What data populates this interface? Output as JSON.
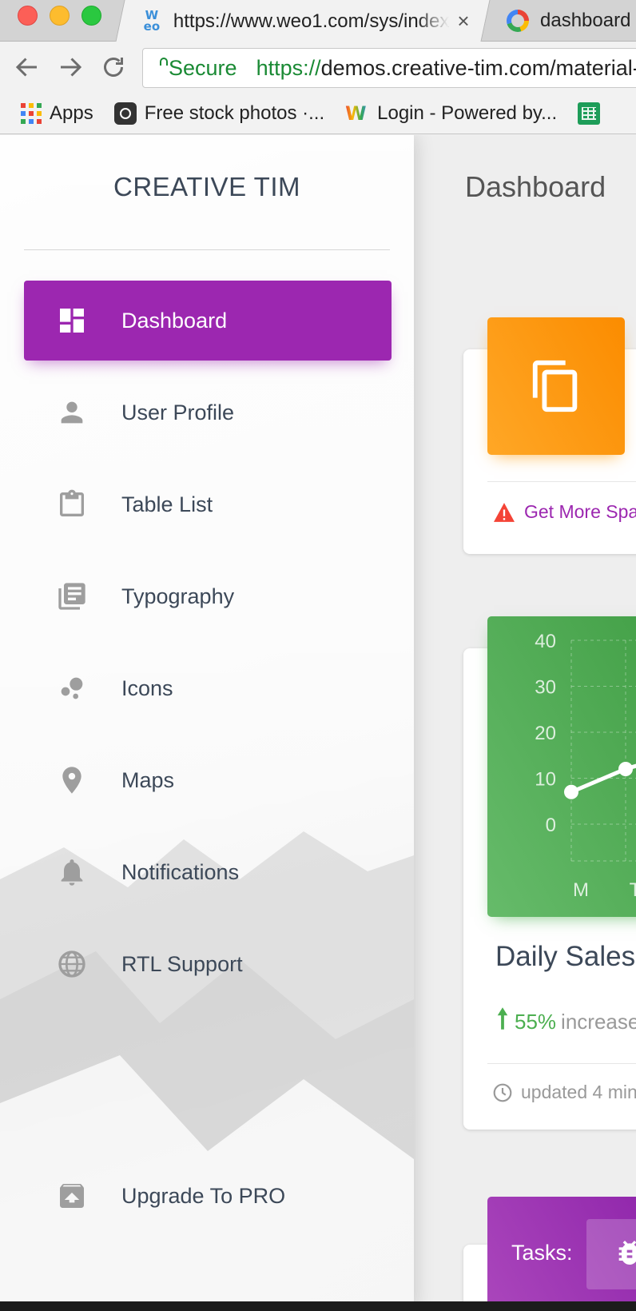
{
  "browser": {
    "active_tab": {
      "title": "https://www.weo1.com/sys/index",
      "close": "×"
    },
    "second_tab": {
      "title": "dashboard"
    },
    "url": {
      "secure_label": "Secure",
      "scheme": "https://",
      "rest": "demos.creative-tim.com/material-dashboard"
    },
    "bookmarks": [
      {
        "label": "Apps",
        "icon": "apps-grid-icon"
      },
      {
        "label": "Free stock photos ·...",
        "icon": "instagram-icon"
      },
      {
        "label": "Login - Powered by...",
        "icon": "w-logo-icon"
      },
      {
        "label": "",
        "icon": "sheets-icon"
      }
    ]
  },
  "sidebar": {
    "brand": "CREATIVE TIM",
    "items": [
      {
        "label": "Dashboard",
        "icon": "dashboard-icon",
        "active": true
      },
      {
        "label": "User Profile",
        "icon": "person-icon"
      },
      {
        "label": "Table List",
        "icon": "clipboard-icon"
      },
      {
        "label": "Typography",
        "icon": "library-books-icon"
      },
      {
        "label": "Icons",
        "icon": "bubble-chart-icon"
      },
      {
        "label": "Maps",
        "icon": "location-pin-icon"
      },
      {
        "label": "Notifications",
        "icon": "bell-icon"
      },
      {
        "label": "RTL Support",
        "icon": "globe-icon"
      }
    ],
    "upgrade": {
      "label": "Upgrade To PRO",
      "icon": "unarchive-icon"
    }
  },
  "main": {
    "title": "Dashboard",
    "card_used_space": {
      "icon": "content-copy-icon",
      "footer_link": "Get More Spa",
      "footer_icon": "warning-icon",
      "accent": "#ff9800"
    },
    "card_daily_sales": {
      "title": "Daily Sales",
      "stat_value": "55%",
      "stat_text": "increase",
      "footer": "updated 4 min",
      "accent": "#4caf50"
    },
    "card_tasks": {
      "label": "Tasks:",
      "icon": "bug-icon",
      "accent": "#9c27b0"
    }
  },
  "chart_data": {
    "type": "line",
    "categories": [
      "M",
      "T"
    ],
    "values": [
      7,
      12
    ],
    "yticks": [
      "40",
      "30",
      "20",
      "10",
      "0"
    ],
    "ylim": [
      0,
      40
    ],
    "grid": true,
    "title": "",
    "xlabel": "",
    "ylabel": ""
  }
}
